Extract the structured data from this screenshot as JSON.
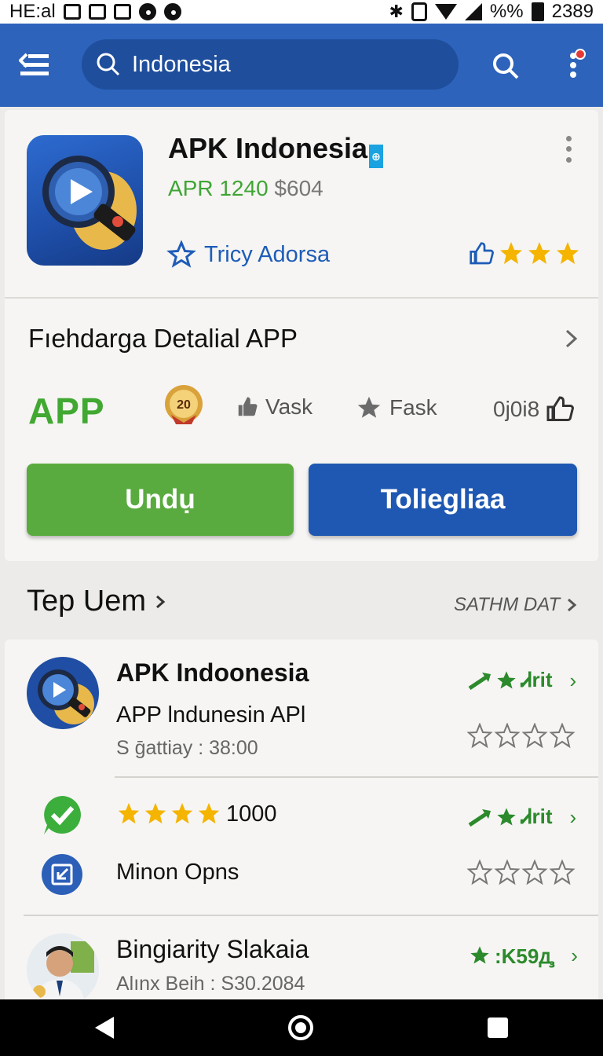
{
  "status_bar": {
    "carrier": "HE:al",
    "battery_percent": "%%",
    "time": "2389"
  },
  "app_bar": {
    "search_value": "Indonesia",
    "icons": [
      "menu-icon",
      "search-icon",
      "more-vert-icon"
    ]
  },
  "featured_app": {
    "title": "APK Indonesia",
    "version": "APR 1240",
    "price": "$604",
    "developer": "Tricy Adorsa",
    "stars": 3,
    "details_title": "Fıehdarga Detalial APP",
    "app_label": "APP",
    "features": [
      {
        "label": "Vask",
        "icon": "thumb-icon"
      },
      {
        "label": "Fask",
        "icon": "star-icon"
      },
      {
        "label": "0j0i8",
        "icon": "thumbs-up-icon"
      }
    ],
    "buttons": {
      "primary": "Undụ",
      "secondary": "Toliegliaa"
    }
  },
  "list_header": {
    "title": "Tep Uem",
    "link": "SATHM DAT"
  },
  "list": {
    "row1": {
      "title": "APK Indoonesia",
      "subtitle": "APP lndunesin APl",
      "meta": "S ḡattiay : 38:00",
      "trend": "Ꮧrit",
      "rating_stars": 0
    },
    "row2": {
      "stars": 4,
      "count": "1000",
      "trend": "Ꮧrit",
      "rating_stars": 0
    },
    "row3": {
      "label": "Minon Opns",
      "rating_stars": 0
    },
    "row4": {
      "title": "Bingiarity Slakaia",
      "meta": "Alınx Beih  :  S30.2084",
      "trend": ":K59ꚉ"
    }
  },
  "colors": {
    "app_bar": "#2d63bb",
    "green": "#5aab3f",
    "blue": "#1f58b2",
    "star": "#f4b400"
  }
}
